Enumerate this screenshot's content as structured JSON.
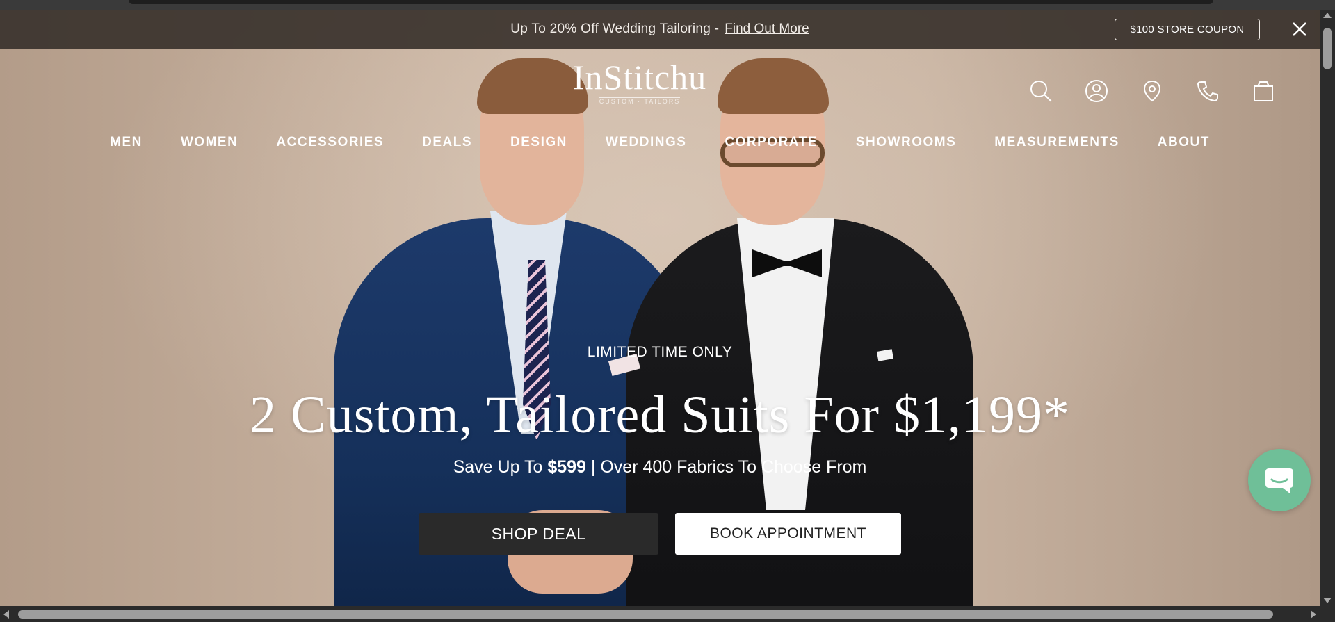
{
  "promo": {
    "text": "Up To 20% Off Wedding Tailoring -",
    "link": "Find Out More",
    "coupon_label": "$100 STORE COUPON",
    "close_icon": "close-icon"
  },
  "brand": {
    "logo": "InStitchu",
    "tagline": "CUSTOM · TAILORS"
  },
  "header_icons": [
    "search-icon",
    "account-icon",
    "location-pin-icon",
    "phone-icon",
    "shopping-bag-icon"
  ],
  "nav": {
    "items": [
      "MEN",
      "WOMEN",
      "ACCESSORIES",
      "DEALS",
      "DESIGN",
      "WEDDINGS",
      "CORPORATE",
      "SHOWROOMS",
      "MEASUREMENTS",
      "ABOUT"
    ]
  },
  "hero": {
    "eyebrow": "LIMITED TIME ONLY",
    "headline": "2 Custom, Tailored Suits For $1,199*",
    "sub_prefix": "Save Up To",
    "sub_bold": "$599",
    "sub_suffix": "| Over 400 Fabrics To Choose From",
    "cta_primary": "SHOP DEAL",
    "cta_secondary": "BOOK APPOINTMENT"
  },
  "chat": {
    "icon": "chat-bubble-icon",
    "color": "#6fbf98"
  },
  "colors": {
    "promo_bg": "#3a322c",
    "button_dark": "#2a2a2a",
    "button_light": "#ffffff"
  }
}
